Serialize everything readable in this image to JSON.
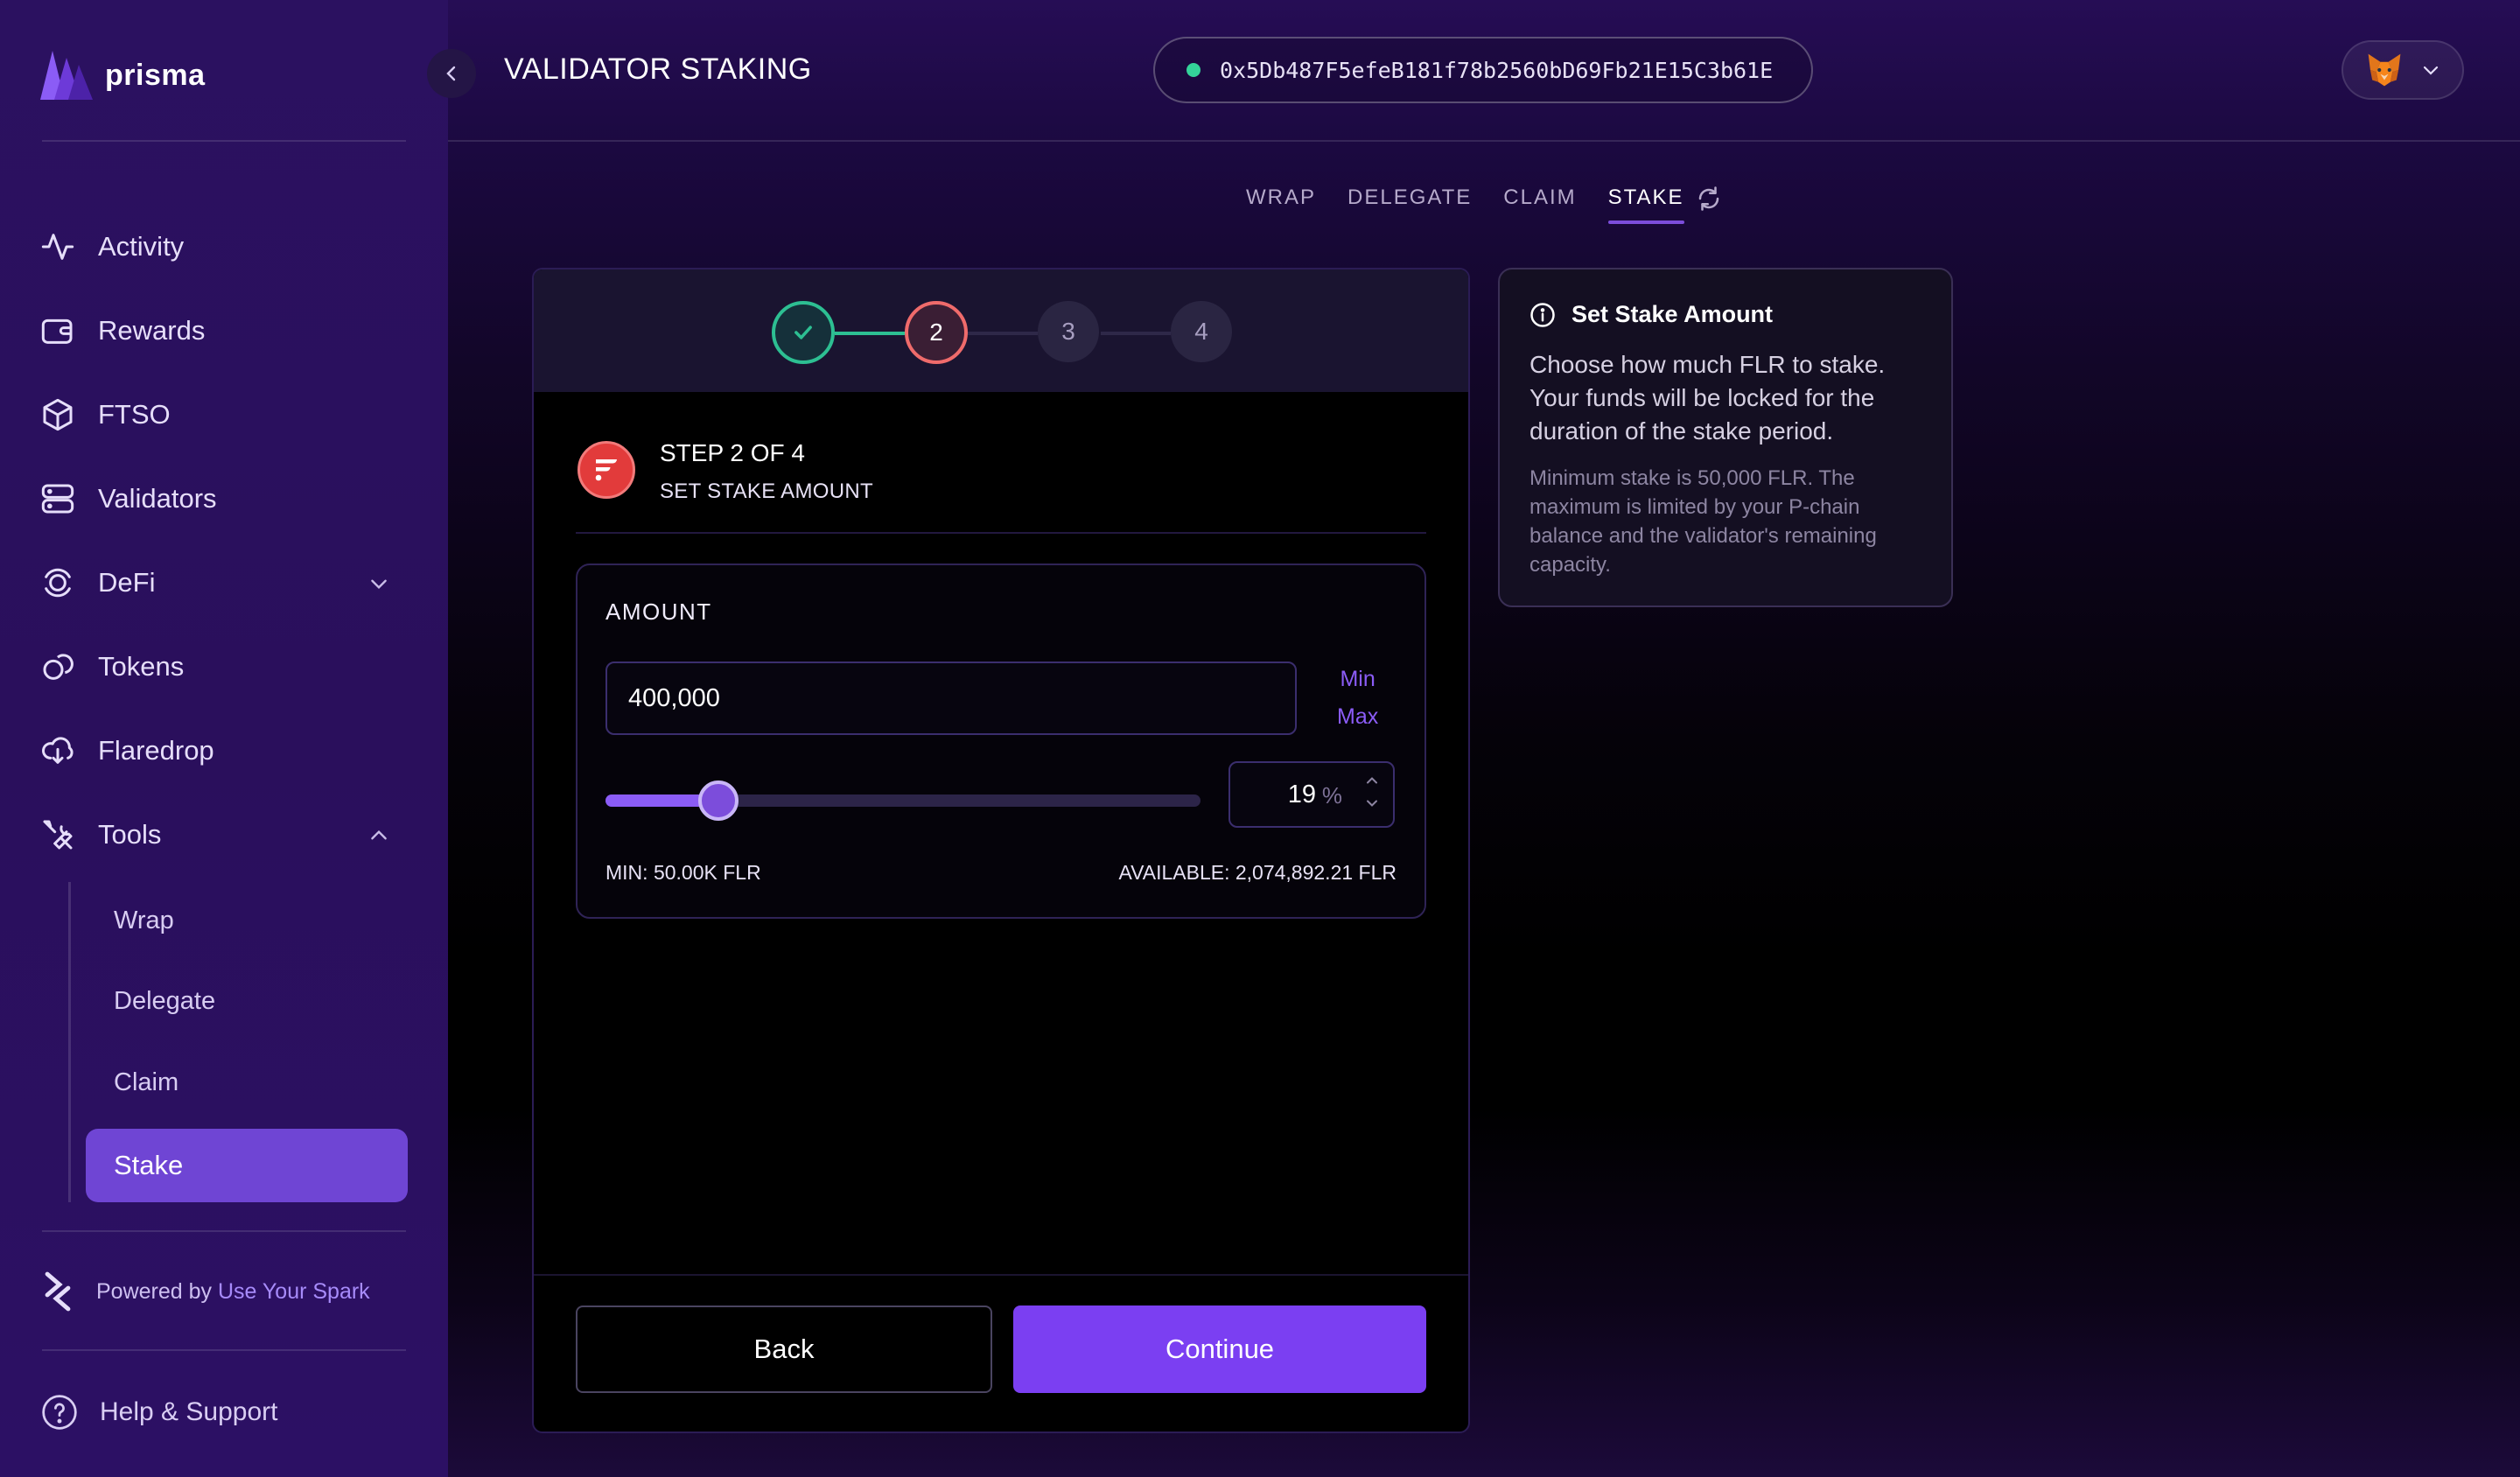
{
  "app": {
    "logo_text": "prisma",
    "page_title": "VALIDATOR STAKING"
  },
  "header": {
    "wallet_address": "0x5Db487F5efeB181f78b2560bD69Fb21E15C3b61E"
  },
  "sidebar": {
    "items": [
      {
        "label": "Activity",
        "icon": "activity-icon"
      },
      {
        "label": "Rewards",
        "icon": "wallet-icon"
      },
      {
        "label": "FTSO",
        "icon": "cube-icon"
      },
      {
        "label": "Validators",
        "icon": "server-icon"
      },
      {
        "label": "DeFi",
        "icon": "defi-icon"
      },
      {
        "label": "Tokens",
        "icon": "coins-icon"
      },
      {
        "label": "Flaredrop",
        "icon": "cloud-download-icon"
      },
      {
        "label": "Tools",
        "icon": "tools-icon"
      }
    ],
    "sub_items": [
      "Wrap",
      "Delegate",
      "Claim",
      "Stake"
    ],
    "powered_prefix": "Powered by ",
    "powered_link": "Use Your Spark",
    "help": "Help & Support"
  },
  "tabs": [
    "WRAP",
    "DELEGATE",
    "CLAIM",
    "STAKE"
  ],
  "active_tab": "STAKE",
  "stepper": {
    "current": "2",
    "step3": "3",
    "step4": "4"
  },
  "card": {
    "step_label": "STEP 2 OF 4",
    "step_sub": "SET STAKE AMOUNT",
    "amount_title": "AMOUNT",
    "amount_value": "400,000",
    "min_label": "Min",
    "max_label": "Max",
    "percent_value": "19",
    "percent_unit": "%",
    "slider_fraction": 0.19,
    "min_text": "MIN: 50.00K FLR",
    "available_text": "AVAILABLE: 2,074,892.21 FLR",
    "back_label": "Back",
    "continue_label": "Continue"
  },
  "info": {
    "title": "Set Stake Amount",
    "main_text": "Choose how much FLR to stake. Your funds will be locked for the duration of the stake period.",
    "small_text": "Minimum stake is 50,000 FLR. The maximum is limited by your P-chain balance and the validator's remaining capacity."
  },
  "colors": {
    "accent": "#7b3ff2",
    "success": "#2dbf92",
    "current_step": "#ef6b6b",
    "online": "#34d399"
  }
}
